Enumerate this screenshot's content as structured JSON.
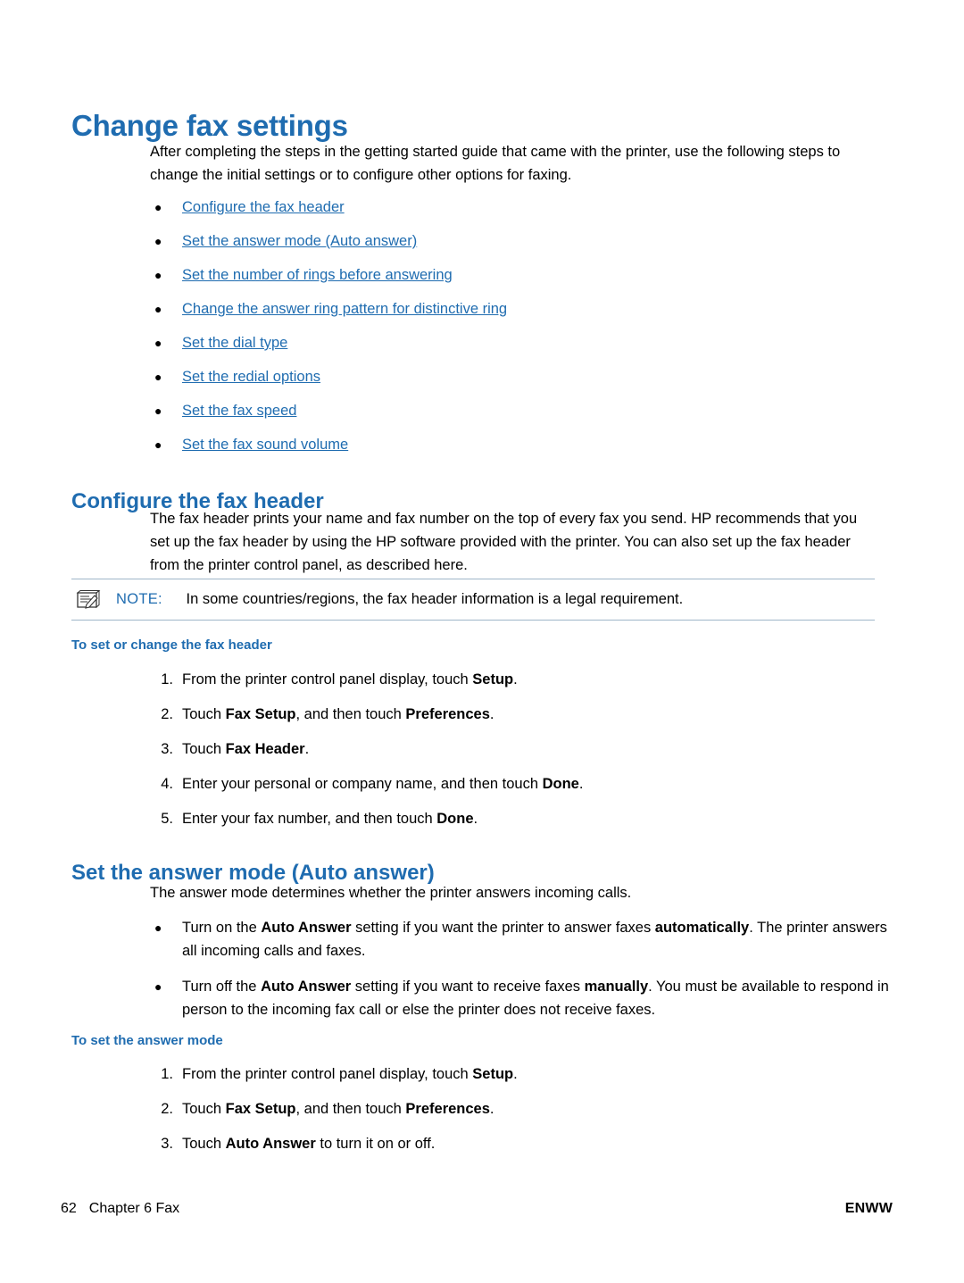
{
  "title": "Change fax settings",
  "intro": "After completing the steps in the getting started guide that came with the printer, use the following steps to change the initial settings or to configure other options for faxing.",
  "links": [
    "Configure the fax header",
    "Set the answer mode (Auto answer)",
    "Set the number of rings before answering",
    "Change the answer ring pattern for distinctive ring",
    "Set the dial type",
    "Set the redial options",
    "Set the fax speed",
    "Set the fax sound volume"
  ],
  "section1": {
    "heading": "Configure the fax header",
    "para": "The fax header prints your name and fax number on the top of every fax you send. HP recommends that you set up the fax header by using the HP software provided with the printer. You can also set up the fax header from the printer control panel, as described here.",
    "note": {
      "label": "NOTE:",
      "text": "In some countries/regions, the fax header information is a legal requirement."
    },
    "proc_heading": "To set or change the fax header",
    "steps": [
      {
        "num": "1.",
        "pre": "From the printer control panel display, touch ",
        "bold": "Setup",
        "post": "."
      },
      {
        "num": "2.",
        "pre": "Touch ",
        "bold": "Fax Setup",
        "mid": ", and then touch ",
        "bold2": "Preferences",
        "post": "."
      },
      {
        "num": "3.",
        "pre": "Touch ",
        "bold": "Fax Header",
        "post": "."
      },
      {
        "num": "4.",
        "pre": "Enter your personal or company name, and then touch ",
        "bold": "Done",
        "post": "."
      },
      {
        "num": "5.",
        "pre": "Enter your fax number, and then touch ",
        "bold": "Done",
        "post": "."
      }
    ]
  },
  "section2": {
    "heading": "Set the answer mode (Auto answer)",
    "para": "The answer mode determines whether the printer answers incoming calls.",
    "bullets": [
      {
        "pre": "Turn on the ",
        "bold": "Auto Answer",
        "mid": " setting if you want the printer to answer faxes ",
        "bold2": "automatically",
        "post": ". The printer answers all incoming calls and faxes."
      },
      {
        "pre": "Turn off the ",
        "bold": "Auto Answer",
        "mid": " setting if you want to receive faxes ",
        "bold2": "manually",
        "post": ". You must be available to respond in person to the incoming fax call or else the printer does not receive faxes."
      }
    ],
    "proc_heading": "To set the answer mode",
    "steps": [
      {
        "num": "1.",
        "pre": "From the printer control panel display, touch ",
        "bold": "Setup",
        "post": "."
      },
      {
        "num": "2.",
        "pre": "Touch ",
        "bold": "Fax Setup",
        "mid": ", and then touch ",
        "bold2": "Preferences",
        "post": "."
      },
      {
        "num": "3.",
        "pre": "Touch ",
        "bold": "Auto Answer",
        "mid": " to turn it on or off.",
        "post": ""
      }
    ]
  },
  "footer": {
    "page_number": "62",
    "chapter": "Chapter 6  Fax",
    "right": "ENWW"
  },
  "colors": {
    "heading_blue": "#1f6cb0",
    "note_rule": "#9fb6c9"
  }
}
